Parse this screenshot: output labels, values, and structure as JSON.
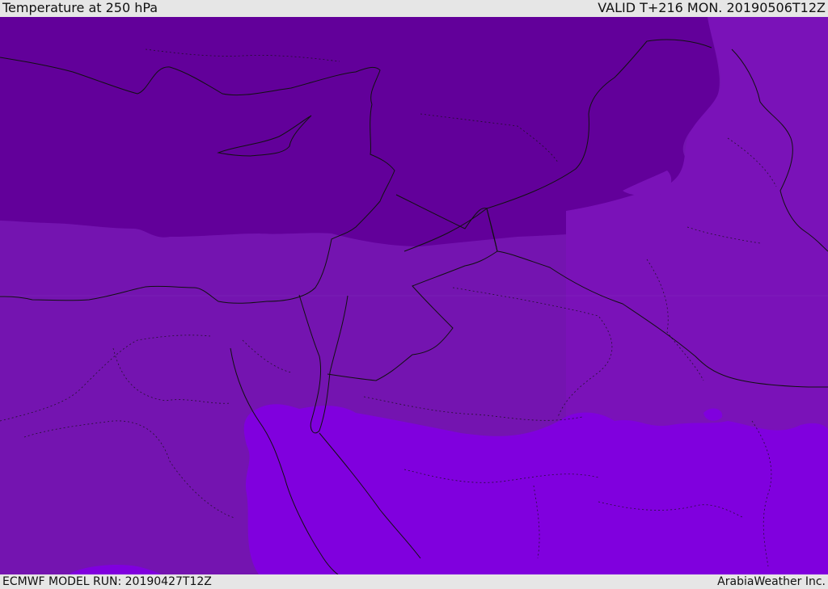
{
  "header": {
    "title": "Temperature at 250 hPa",
    "valid": "VALID T+216 MON. 20190506T12Z"
  },
  "footer": {
    "model_run": "ECMWF MODEL RUN: 20190427T12Z",
    "credit": "ArabiaWeather Inc."
  },
  "map": {
    "field": "temperature_250hPa",
    "colors": {
      "coldest": "#62009a",
      "cold": "#7a12b8",
      "mid": "#7414b0",
      "warm": "#8000de",
      "border": "#111111"
    }
  }
}
